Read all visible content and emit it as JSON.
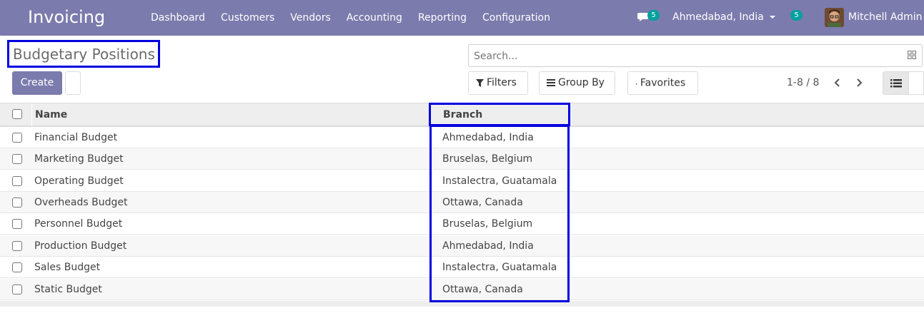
{
  "app": {
    "title": "Invoicing"
  },
  "menu": [
    "Dashboard",
    "Customers",
    "Vendors",
    "Accounting",
    "Reporting",
    "Configuration"
  ],
  "systray": {
    "chat_count": "5",
    "company": "Ahmedabad, India",
    "activity_count": "5",
    "user": "Mitchell Admin"
  },
  "breadcrumb": "Budgetary Positions",
  "buttons": {
    "create": "Create"
  },
  "search": {
    "placeholder": "Search..."
  },
  "filters": {
    "filters": "Filters",
    "group_by": "Group By",
    "favorites": "Favorites"
  },
  "pager": "1-8 / 8",
  "columns": {
    "name": "Name",
    "branch": "Branch"
  },
  "rows": [
    {
      "name": "Financial Budget",
      "branch": "Ahmedabad, India"
    },
    {
      "name": "Marketing Budget",
      "branch": "Bruselas, Belgium"
    },
    {
      "name": "Operating Budget",
      "branch": "Instalectra, Guatamala"
    },
    {
      "name": "Overheads Budget",
      "branch": "Ottawa, Canada"
    },
    {
      "name": "Personnel Budget",
      "branch": "Bruselas, Belgium"
    },
    {
      "name": "Production Budget",
      "branch": "Ahmedabad, India"
    },
    {
      "name": "Sales Budget",
      "branch": "Instalectra, Guatamala"
    },
    {
      "name": "Static Budget",
      "branch": "Ottawa, Canada"
    }
  ],
  "colors": {
    "brand": "#7c7bad",
    "badge": "#00a09d",
    "highlight": "#0000e0"
  }
}
